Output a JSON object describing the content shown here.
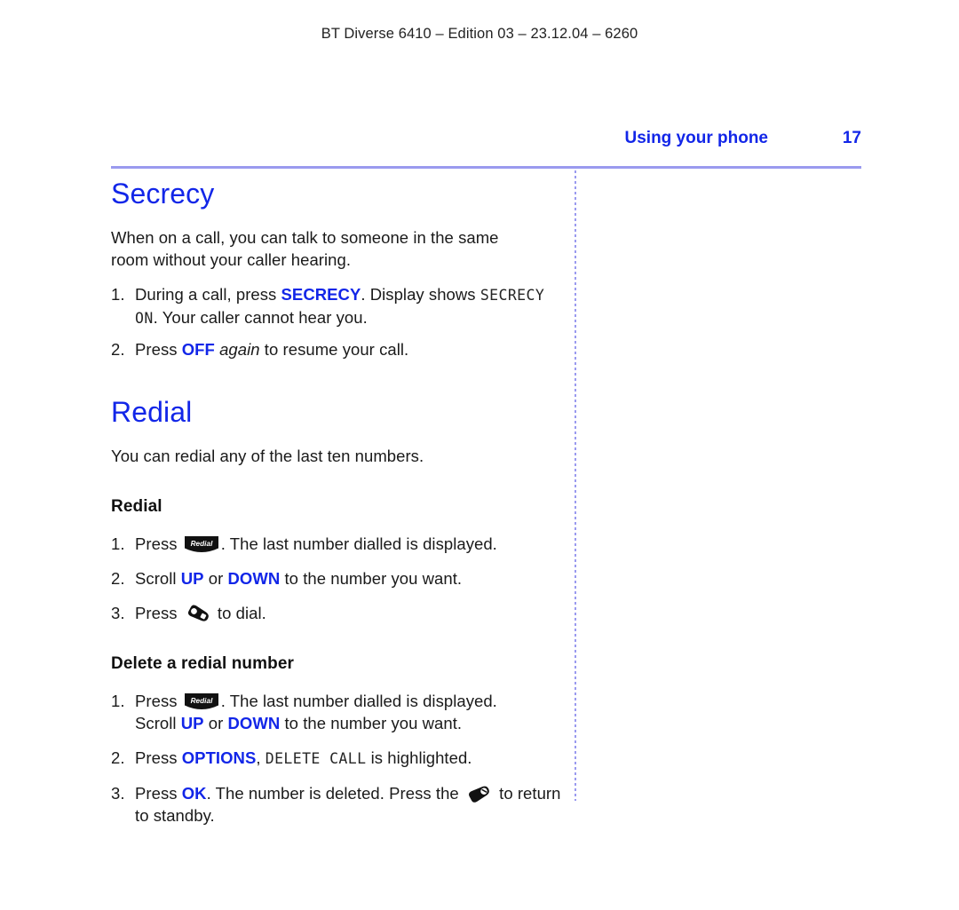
{
  "running_head": "BT Diverse 6410 – Edition 03 – 23.12.04 – 6260",
  "header": {
    "section_title": "Using your phone",
    "page_number": "17"
  },
  "colors": {
    "heading_blue": "#1226e8",
    "rule_lavender": "#9a9aef",
    "body_black": "#1a1a1a"
  },
  "sections": [
    {
      "heading": "Secrecy",
      "intro_line1": "When on a call, you can talk to someone in the same",
      "intro_line2": "room without your caller hearing.",
      "steps": [
        {
          "num": "1.",
          "a": "During a call, press ",
          "key1": "SECRECY",
          "b": ". Display shows ",
          "lcd1": "SECRECY",
          "c": " ",
          "lcd2": "ON",
          "d": ". Your caller cannot hear you."
        },
        {
          "num": "2.",
          "a": "Press ",
          "key1": "OFF",
          "b": " ",
          "ital": "again",
          "c": " to resume your call."
        }
      ]
    },
    {
      "heading": "Redial",
      "intro": "You can redial any of the last ten numbers.",
      "sub1": {
        "heading": "Redial",
        "steps": [
          {
            "num": "1.",
            "a": "Press ",
            "icon": "redial-key-icon",
            "icon_label": "Redial",
            "b": ". The last number dialled is displayed."
          },
          {
            "num": "2.",
            "a": "Scroll ",
            "key1": "UP",
            "b": " or ",
            "key2": "DOWN",
            "c": " to the number you want."
          },
          {
            "num": "3.",
            "a": "Press ",
            "icon": "talk-key-icon",
            "b": " to dial."
          }
        ]
      },
      "sub2": {
        "heading": "Delete a redial number",
        "steps": [
          {
            "num": "1.",
            "a": "Press ",
            "icon": "redial-key-icon",
            "icon_label": "Redial",
            "b": ". The last number dialled is displayed.",
            "line2_a": "Scroll ",
            "line2_key1": "UP",
            "line2_b": " or ",
            "line2_key2": "DOWN",
            "line2_c": " to the number you want."
          },
          {
            "num": "2.",
            "a": "Press ",
            "key1": "OPTIONS",
            "b": ", ",
            "lcd1": "DELETE CALL",
            "c": " is highlighted."
          },
          {
            "num": "3.",
            "a": "Press ",
            "key1": "OK",
            "b": ". The number is deleted. Press the ",
            "icon": "end-call-key-icon",
            "c": " to return",
            "line2": "to standby."
          }
        ]
      }
    }
  ]
}
